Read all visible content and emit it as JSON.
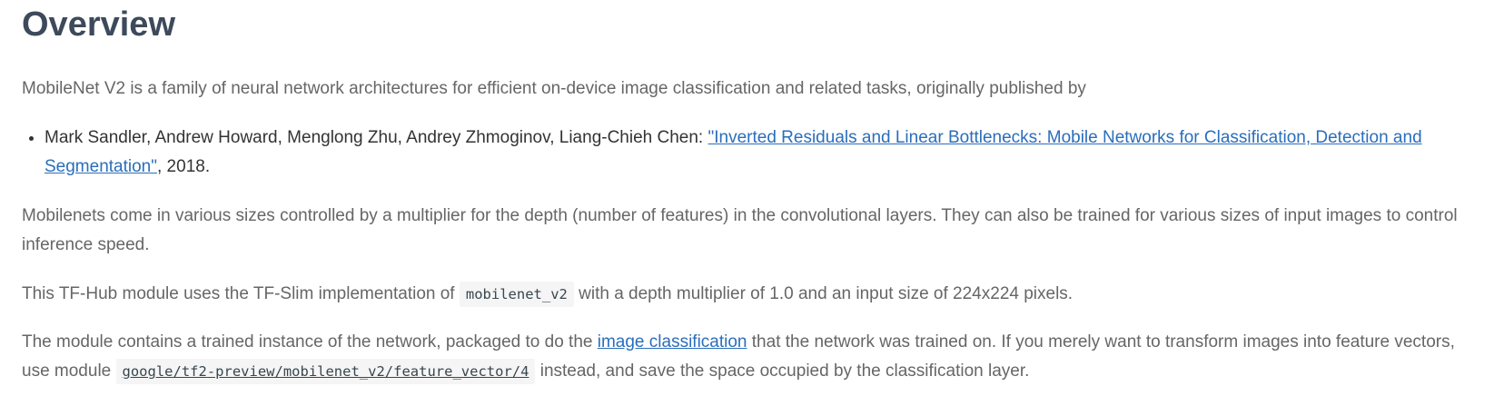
{
  "heading": "Overview",
  "intro": "MobileNet V2 is a family of neural network architectures for efficient on-device image classification and related tasks, originally published by",
  "citation": {
    "authors": "Mark Sandler, Andrew Howard, Menglong Zhu, Andrey Zhmoginov, Liang-Chieh Chen: ",
    "link_text": "\"Inverted Residuals and Linear Bottlenecks: Mobile Networks for Classification, Detection and Segmentation\"",
    "suffix": ", 2018."
  },
  "para_sizes": "Mobilenets come in various sizes controlled by a multiplier for the depth (number of features) in the convolutional layers. They can also be trained for various sizes of input images to control inference speed.",
  "para_impl": {
    "before": "This TF-Hub module uses the TF-Slim implementation of ",
    "code": "mobilenet_v2",
    "after": " with a depth multiplier of 1.0 and an input size of 224x224 pixels."
  },
  "para_module": {
    "before": "The module contains a trained instance of the network, packaged to do the ",
    "link_text": "image classification",
    "middle": " that the network was trained on. If you merely want to transform images into feature vectors, use module ",
    "code_link": "google/tf2-preview/mobilenet_v2/feature_vector/4",
    "after": " instead, and save the space occupied by the classification layer."
  },
  "colors": {
    "heading": "#3d4a5c",
    "body_text": "#666666",
    "list_text": "#333333",
    "link": "#2a6ebb",
    "code_bg": "#f5f5f5"
  }
}
